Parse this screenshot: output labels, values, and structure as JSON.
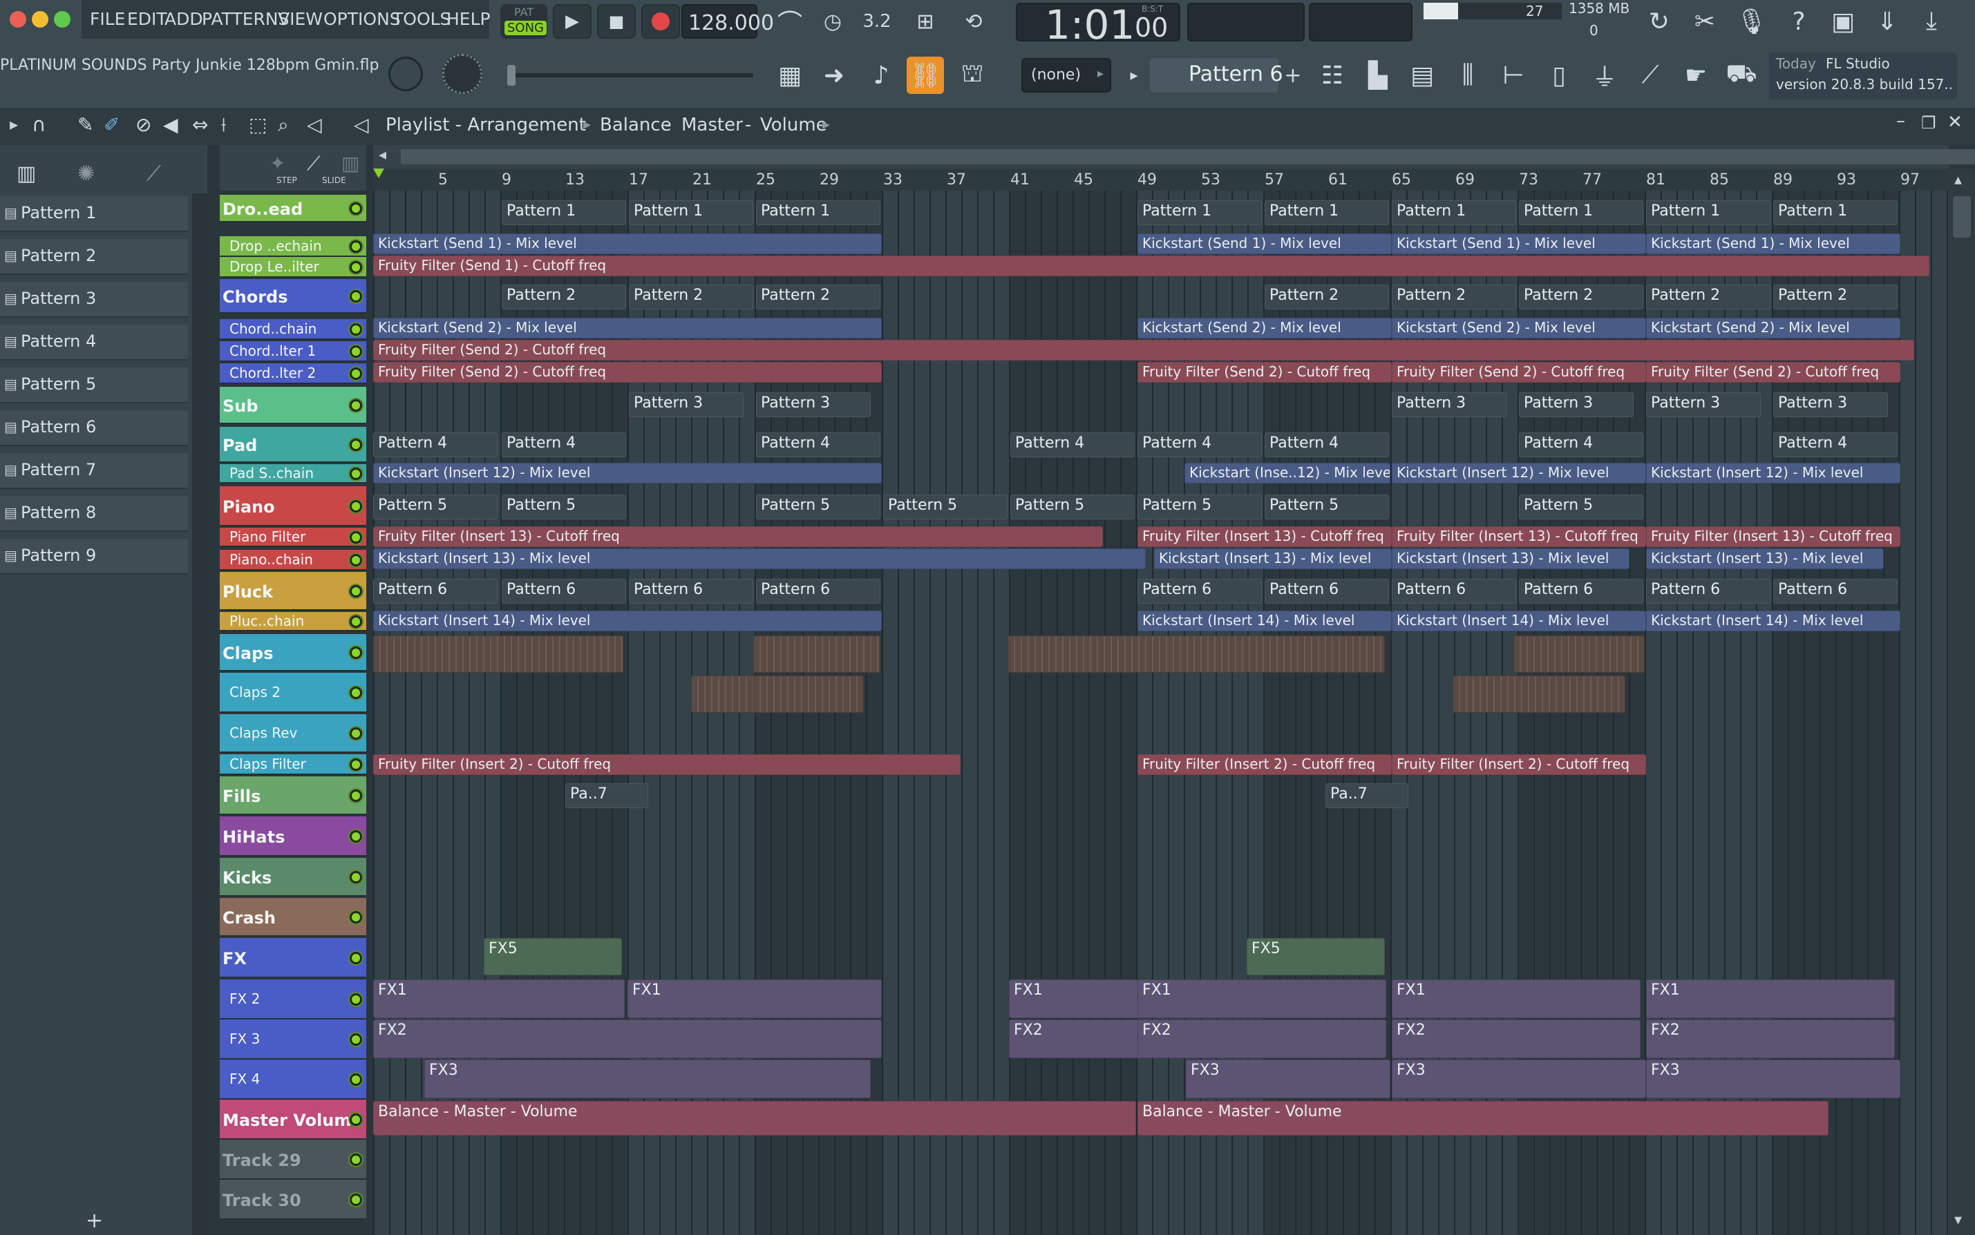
{
  "menu": {
    "items": [
      "FILE",
      "EDIT",
      "ADD",
      "PATTERNS",
      "VIEW",
      "OPTIONS",
      "TOOLS",
      "HELP"
    ]
  },
  "transport": {
    "mode_pat": "PAT",
    "mode_song": "SONG",
    "tempo": "128.000",
    "time": "1:01",
    "time_sub": "00",
    "time_label": "B:S:T",
    "memory": "1358 MB",
    "cpu": "27",
    "voices": "0"
  },
  "project": {
    "filename": "PLATINUM SOUNDS Party Junkie 128bpm Gmin.flp"
  },
  "pattern_selector": {
    "current": "Pattern 6",
    "channel": "(none)"
  },
  "news": {
    "label": "Today",
    "app": "FL Studio",
    "version": "version 20.8.3 build 157.."
  },
  "playlist": {
    "title": "Playlist - Arrangement",
    "breadcrumb": [
      "Balance",
      "Master",
      "Volume"
    ],
    "step_label": "STEP",
    "slide_label": "SLIDE"
  },
  "patterns": [
    "Pattern 1",
    "Pattern 2",
    "Pattern 3",
    "Pattern 4",
    "Pattern 5",
    "Pattern 6",
    "Pattern 7",
    "Pattern 8",
    "Pattern 9"
  ],
  "ruler": [
    "5",
    "9",
    "13",
    "17",
    "21",
    "25",
    "29",
    "33",
    "37",
    "41",
    "45",
    "49",
    "53",
    "57",
    "61",
    "65",
    "69",
    "73",
    "77",
    "81",
    "85",
    "89",
    "93",
    "97"
  ],
  "tracks": [
    {
      "name": "Dro..ead",
      "color": "#7ab84a",
      "type": "main"
    },
    {
      "name": "Drop ..echain",
      "color": "#7ab84a",
      "type": "sub"
    },
    {
      "name": "Drop Le..ilter",
      "color": "#7ab84a",
      "type": "sub"
    },
    {
      "name": "Chords",
      "color": "#4a5cc6",
      "type": "main"
    },
    {
      "name": "Chord..chain",
      "color": "#4a5cc6",
      "type": "sub"
    },
    {
      "name": "Chord..lter 1",
      "color": "#4a5cc6",
      "type": "sub"
    },
    {
      "name": "Chord..lter 2",
      "color": "#4a5cc6",
      "type": "sub"
    },
    {
      "name": "Sub",
      "color": "#5bbf8a",
      "type": "main"
    },
    {
      "name": "Pad",
      "color": "#3fa7a0",
      "type": "main"
    },
    {
      "name": "Pad S..chain",
      "color": "#3fa7a0",
      "type": "sub"
    },
    {
      "name": "Piano",
      "color": "#c84848",
      "type": "main"
    },
    {
      "name": "Piano Filter",
      "color": "#c84848",
      "type": "sub"
    },
    {
      "name": "Piano..chain",
      "color": "#c84848",
      "type": "sub"
    },
    {
      "name": "Pluck",
      "color": "#c8a040",
      "type": "main"
    },
    {
      "name": "Pluc..chain",
      "color": "#c8a040",
      "type": "sub"
    },
    {
      "name": "Claps",
      "color": "#3aa4c0",
      "type": "main"
    },
    {
      "name": "Claps 2",
      "color": "#3aa4c0",
      "type": "sub"
    },
    {
      "name": "Claps Rev",
      "color": "#3aa4c0",
      "type": "sub"
    },
    {
      "name": "Claps Filter",
      "color": "#3aa4c0",
      "type": "sub"
    },
    {
      "name": "Fills",
      "color": "#6aa66a",
      "type": "main"
    },
    {
      "name": "HiHats",
      "color": "#8a4aa0",
      "type": "main"
    },
    {
      "name": "Kicks",
      "color": "#5a8a6a",
      "type": "main"
    },
    {
      "name": "Crash",
      "color": "#8a6a5a",
      "type": "main"
    },
    {
      "name": "FX",
      "color": "#4a5cc6",
      "type": "main"
    },
    {
      "name": "FX 2",
      "color": "#4a5cc6",
      "type": "sub"
    },
    {
      "name": "FX 3",
      "color": "#4a5cc6",
      "type": "sub"
    },
    {
      "name": "FX 4",
      "color": "#4a5cc6",
      "type": "sub"
    },
    {
      "name": "Master Volume",
      "color": "#c04a78",
      "type": "main"
    },
    {
      "name": "Track 29",
      "color": "#4a565c",
      "type": "empty"
    },
    {
      "name": "Track 30",
      "color": "#4a565c",
      "type": "empty"
    }
  ],
  "clips": {
    "p1": "Pattern 1",
    "p2": "Pattern 2",
    "p3": "Pattern 3",
    "p4": "Pattern 4",
    "p5": "Pattern 5",
    "p6": "Pattern 6",
    "pa7": "Pa..7",
    "ks1": "Kickstart (Send 1) - Mix level",
    "ff1": "Fruity Filter (Send 1) - Cutoff freq",
    "ks2": "Kickstart (Send 2) - Mix level",
    "ff2": "Fruity Filter (Send 2) - Cutoff freq",
    "ksi12": "Kickstart (Insert 12) - Mix level",
    "ksi12s": "Kickstart (Inse..12) - Mix level",
    "ffi13": "Fruity Filter (Insert 13) - Cutoff freq",
    "ksi13": "Kickstart (Insert 13) - Mix level",
    "ksi14": "Kickstart (Insert 14) - Mix level",
    "ffi2": "Fruity Filter (Insert 2) - Cutoff freq",
    "fx1": "FX1",
    "fx2": "FX2",
    "fx3": "FX3",
    "fx5": "FX5",
    "master": "Balance - Master - Volume"
  }
}
